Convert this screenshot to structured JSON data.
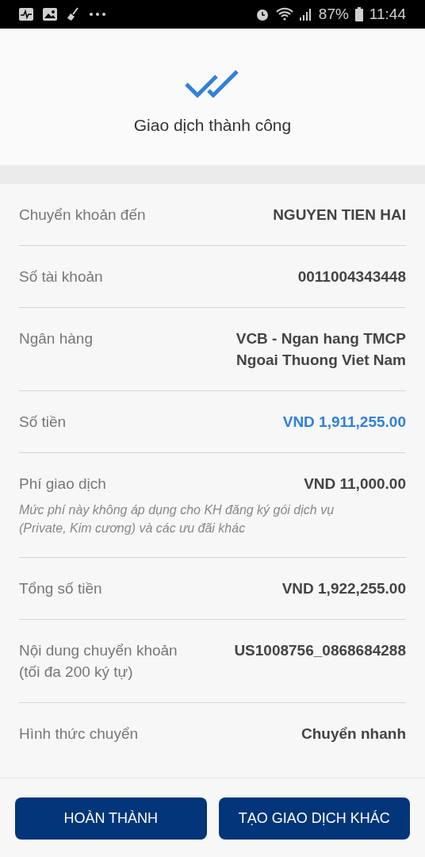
{
  "status_bar": {
    "battery": "87%",
    "time": "11:44"
  },
  "header": {
    "title": "Giao dịch thành công"
  },
  "rows": [
    {
      "label": [
        "Chuyển khoản đến"
      ],
      "value": [
        "NGUYEN TIEN HAI"
      ],
      "highlighted": false
    },
    {
      "label": [
        "Số tài khoản"
      ],
      "value": [
        "0011004343448"
      ],
      "highlighted": false
    },
    {
      "label": [
        "Ngân hàng"
      ],
      "value": [
        "VCB - Ngan hang TMCP",
        "Ngoai Thuong Viet Nam"
      ],
      "highlighted": false
    },
    {
      "label": [
        "Số tiền"
      ],
      "value": [
        "VND 1,911,255.00"
      ],
      "highlighted": true
    },
    {
      "label": [
        "Phí giao dịch"
      ],
      "value": [
        "VND 11,000.00"
      ],
      "highlighted": false,
      "note": "Mức phí này không áp dụng cho KH đăng ký gói dịch vụ (Private, Kim cương) và các ưu đãi khác"
    },
    {
      "label": [
        "Tổng số tiền"
      ],
      "value": [
        "VND 1,922,255.00"
      ],
      "highlighted": false
    },
    {
      "label": [
        "Nội dung chuyển khoản",
        "(tối đa 200 ký tự)"
      ],
      "value": [
        "US1008756_0868684288"
      ],
      "highlighted": false
    },
    {
      "label": [
        "Hình thức chuyển"
      ],
      "value": [
        "Chuyển nhanh"
      ],
      "highlighted": false
    }
  ],
  "buttons": [
    "HOÀN THÀNH",
    "TẠO GIAO DỊCH KHÁC"
  ]
}
